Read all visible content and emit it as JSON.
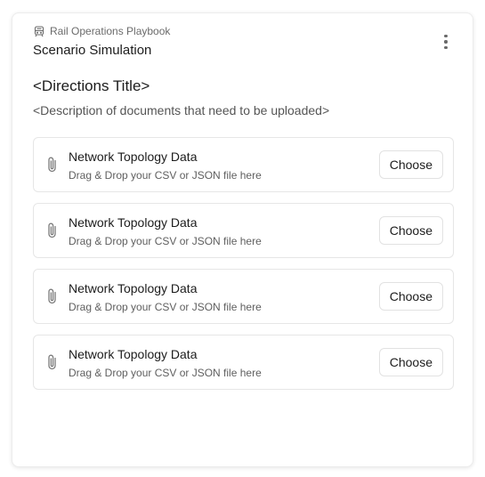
{
  "header": {
    "breadcrumb": "Rail Operations Playbook",
    "breadcrumb_icon": "train-icon",
    "title": "Scenario Simulation",
    "menu_icon": "more-vertical-icon"
  },
  "directions": {
    "title": "<Directions Title>",
    "description": "<Description of documents that need to be uploaded>"
  },
  "uploads": [
    {
      "title": "Network Topology Data",
      "subtitle": "Drag & Drop your CSV or JSON file here",
      "button": "Choose",
      "icon": "paperclip-icon"
    },
    {
      "title": "Network Topology Data",
      "subtitle": "Drag & Drop your CSV or JSON file here",
      "button": "Choose",
      "icon": "paperclip-icon"
    },
    {
      "title": "Network Topology Data",
      "subtitle": "Drag & Drop your CSV or JSON file here",
      "button": "Choose",
      "icon": "paperclip-icon"
    },
    {
      "title": "Network Topology Data",
      "subtitle": "Drag & Drop your CSV or JSON file here",
      "button": "Choose",
      "icon": "paperclip-icon"
    }
  ]
}
